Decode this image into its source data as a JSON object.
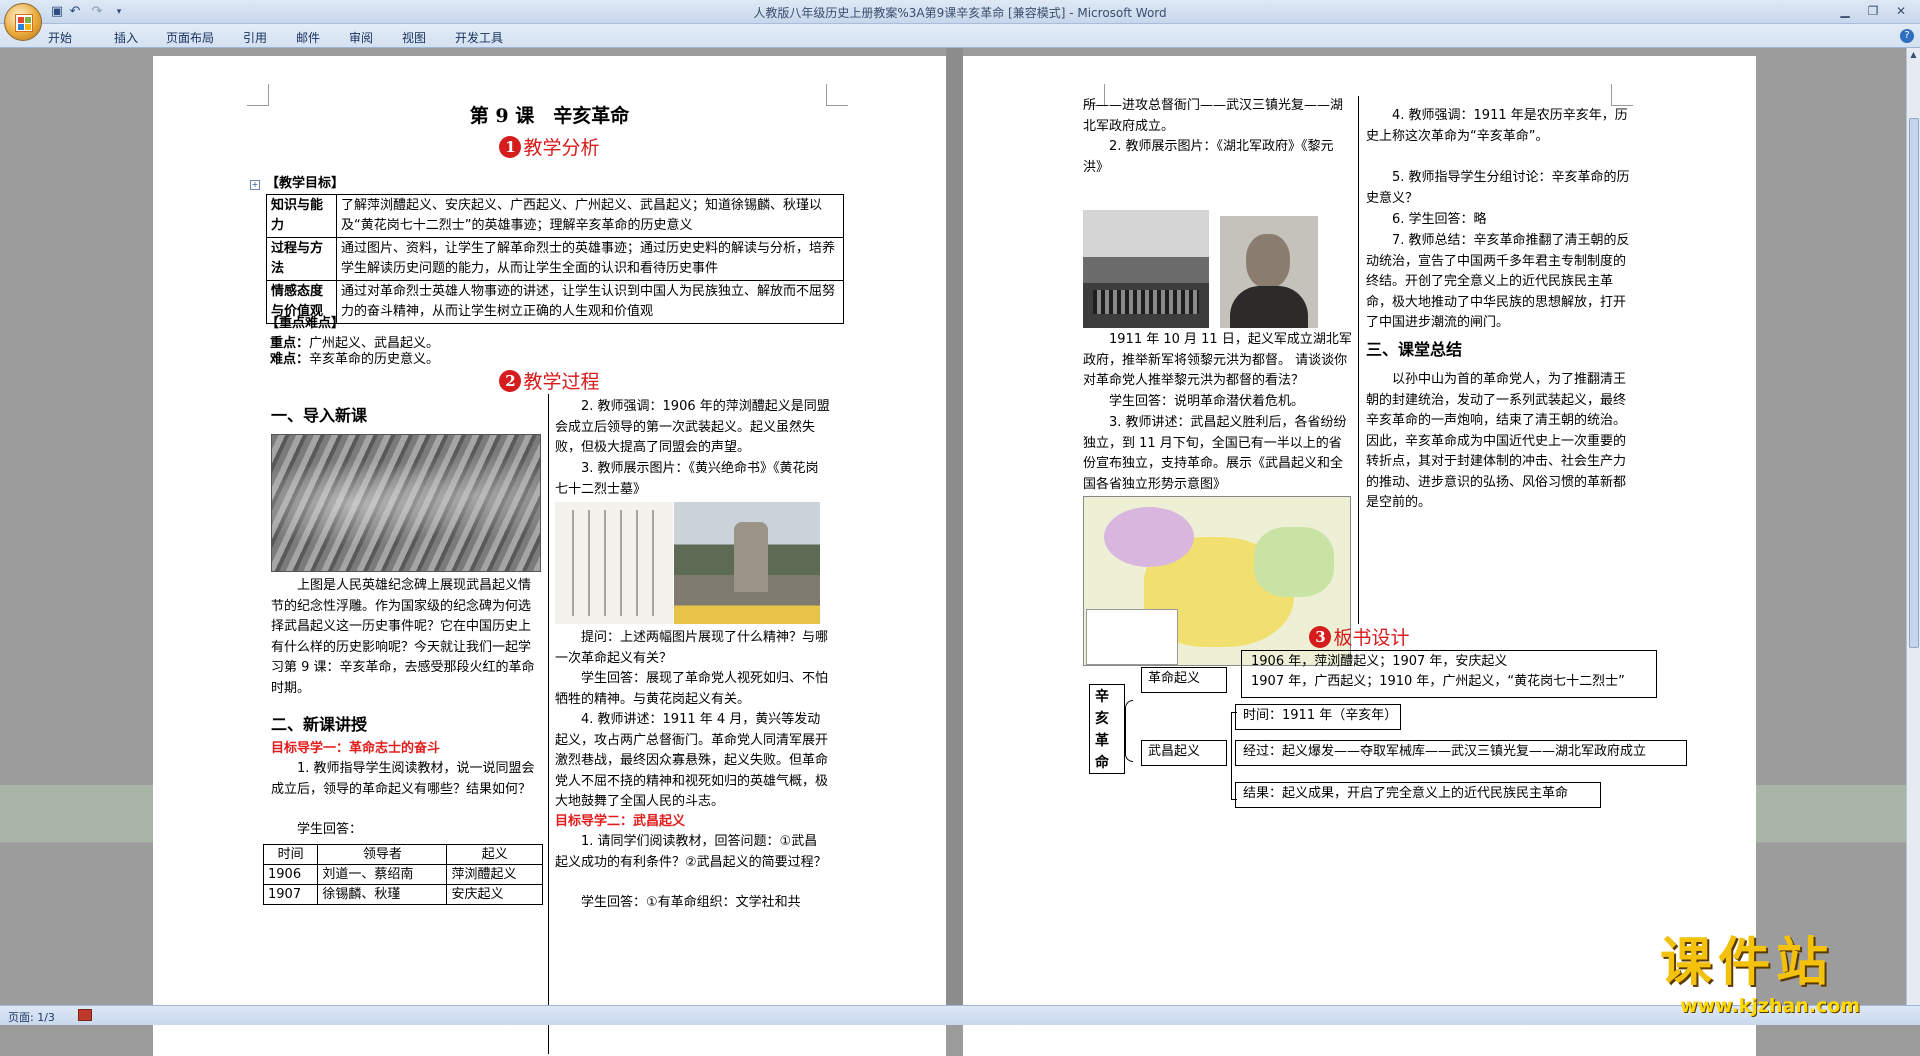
{
  "window": {
    "title": "人教版八年级历史上册教案%3A第9课辛亥革命 [兼容模式] - Microsoft Word"
  },
  "qat": {
    "save_icon": "save-icon",
    "undo_icon": "undo-icon",
    "redo_icon": "redo-icon",
    "customize_icon": "dropdown-icon"
  },
  "ribbon": {
    "tabs": [
      "开始",
      "插入",
      "页面布局",
      "引用",
      "邮件",
      "审阅",
      "视图",
      "开发工具"
    ]
  },
  "statusbar": {
    "page": "页面: 1/3"
  },
  "page1": {
    "title": "第 9 课　辛亥革命",
    "sec1": {
      "num": "1",
      "text": "教学分析"
    },
    "goals_head": "【教学目标】",
    "goals": [
      {
        "k": "知识与能力",
        "v": "了解萍浏醴起义、安庆起义、广西起义、广州起义、武昌起义；知道徐锡麟、秋瑾以及“黄花岗七十二烈士”的英雄事迹；理解辛亥革命的历史意义"
      },
      {
        "k": "过程与方法",
        "v": "通过图片、资料，让学生了解革命烈士的英雄事迹；通过历史史料的解读与分析，培养学生解读历史问题的能力，从而让学生全面的认识和看待历史事件"
      },
      {
        "k": "情感态度与价值观",
        "v": "通过对革命烈士英雄人物事迹的讲述，让学生认识到中国人为民族独立、解放而不屈努力的奋斗精神，从而让学生树立正确的人生观和价值观"
      }
    ],
    "key_head": "【重点难点】",
    "key_label": "重点：",
    "key_text": "广州起义、武昌起义。",
    "diff_label": "难点：",
    "diff_text": "辛亥革命的历史意义。",
    "sec2": {
      "num": "2",
      "text": "教学过程"
    },
    "intro_head": "一、导入新课",
    "intro_text": "上图是人民英雄纪念碑上展现武昌起义情节的纪念性浮雕。作为国家级的纪念碑为何选择武昌起义这一历史事件呢？它在中国历史上有什么样的历史影响呢？今天就让我们一起学习第 9 课：辛亥革命，去感受那段火红的革命时期。",
    "new_head": "二、新课讲授",
    "goal1": "目标导学一：革命志士的奋斗",
    "q1": "1. 教师指导学生阅读教材，说一说同盟会成立后，领导的革命起义有哪些？结果如何？",
    "ans_label": "学生回答：",
    "table_head": [
      "时间",
      "领导者",
      "起义"
    ],
    "table_rows": [
      [
        "1906",
        "刘道一、蔡绍南",
        "萍浏醴起义"
      ],
      [
        "1907",
        "徐锡麟、秋瑾",
        "安庆起义"
      ]
    ],
    "right_col": [
      "2. 教师强调：1906 年的萍浏醴起义是同盟会成立后领导的第一次武装起义。起义虽然失败，但极大提高了同盟会的声望。",
      "3. 教师展示图片：《黄兴绝命书》《黄花岗七十二烈士墓》"
    ],
    "right_col2": [
      "提问：上述两幅图片展现了什么精神？与哪一次革命起义有关？",
      "学生回答：展现了革命党人视死如归、不怕牺牲的精神。与黄花岗起义有关。",
      "4. 教师讲述：1911 年 4 月，黄兴等发动起义，攻占两广总督衙门。革命党人同清军展开激烈巷战，最终因众寡悬殊，起义失败。但革命党人不屈不挠的精神和视死如归的英雄气概，极大地鼓舞了全国人民的斗志。"
    ],
    "goal2": "目标导学二：武昌起义",
    "q2": "1. 请同学们阅读教材，回答问题：①武昌起义成功的有利条件？②武昌起义的简要过程？",
    "q2_ans": "学生回答：①有革命组织：文学社和共"
  },
  "page2": {
    "col1_top": "所——进攻总督衙门——武汉三镇光复——湖北军政府成立。",
    "col1_img_caption": "2. 教师展示图片：《湖北军政府》《黎元洪》",
    "col1_mid": "1911 年 10 月 11 日，起义军成立湖北军政府，推举新军将领黎元洪为都督。 请谈谈你对革命党人推举黎元洪为都督的看法？",
    "col1_ans": "学生回答：说明革命潜伏着危机。",
    "col1_3": "3. 教师讲述：武昌起义胜利后，各省纷纷独立，到 11 月下旬，全国已有一半以上的省份宣布独立，支持革命。展示《武昌起义和全国各省独立形势示意图》",
    "col2": [
      "4. 教师强调：1911 年是农历辛亥年，历史上称这次革命为“辛亥革命”。",
      "5. 教师指导学生分组讨论：辛亥革命的历史意义？",
      "6. 学生回答：略",
      "7. 教师总结：辛亥革命推翻了清王朝的反动统治，宣告了中国两千多年君主专制制度的终结。开创了完全意义上的近代民族民主革命，极大地推动了中华民族的思想解放，打开了中国进步潮流的闸门。"
    ],
    "summary_head": "三、课堂总结",
    "summary": "以孙中山为首的革命党人，为了推翻清王朝的封建统治，发动了一系列武装起义，最终辛亥革命的一声炮响，结束了清王朝的统治。因此，辛亥革命成为中国近代史上一次重要的转折点，其对于封建体制的冲击、社会生产力的推动、进步意识的弘扬、风俗习惯的革新都是空前的。",
    "sec3": {
      "num": "3",
      "text": "板书设计"
    },
    "board": {
      "root": "辛亥革命",
      "b1": "革命起义",
      "b1_line1": "1906 年，萍浏醴起义；1907 年，安庆起义",
      "b1_line2": "1907 年，广西起义；1910 年，广州起义，“黄花岗七十二烈士”",
      "b2": "武昌起义",
      "b2_time": "时间：1911 年（辛亥年）",
      "b2_proc": "经过：起义爆发——夺取军械库——武汉三镇光复——湖北军政府成立",
      "b2_result": "结果：起义成果，开启了完全意义上的近代民族民主革命"
    }
  },
  "watermark": {
    "line1": "课件站",
    "line2": "www.kjzhan.com"
  },
  "colors": {
    "accent_red": "#d91a1a",
    "ribbon_blue": "#d4e1f1",
    "workspace_gray": "#9c9c9c"
  }
}
